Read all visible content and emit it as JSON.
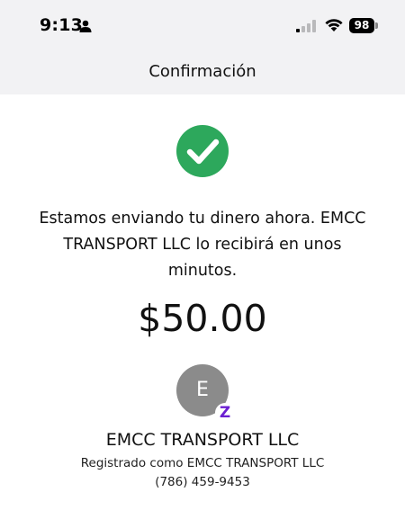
{
  "status_bar": {
    "time": "9:13",
    "battery": "98",
    "icons": [
      "person-icon",
      "signal-icon",
      "wifi-icon",
      "battery-icon"
    ]
  },
  "nav": {
    "title": "Confirmación"
  },
  "confirmation": {
    "status_icon": "checkmark-icon",
    "status_color": "#2da85c",
    "message": "Estamos enviando tu dinero ahora. EMCC TRANSPORT LLC lo recibirá en unos minutos.",
    "amount": "$50.00"
  },
  "recipient": {
    "avatar_initial": "E",
    "badge_letter": "Z",
    "badge_color": "#6b1fd1",
    "name": "EMCC TRANSPORT LLC",
    "registered_as": "Registrado como EMCC TRANSPORT LLC",
    "phone": "(786) 459-9453"
  }
}
